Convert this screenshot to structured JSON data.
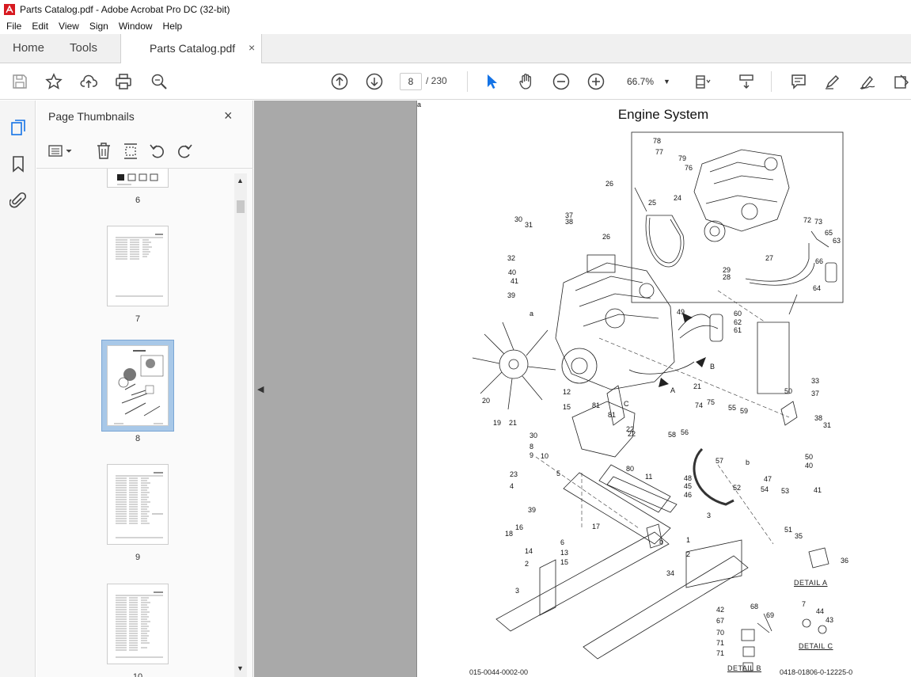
{
  "window": {
    "title": "Parts Catalog.pdf - Adobe Acrobat Pro DC (32-bit)"
  },
  "menu": [
    "File",
    "Edit",
    "View",
    "Sign",
    "Window",
    "Help"
  ],
  "tabs": {
    "home": "Home",
    "tools": "Tools",
    "document": "Parts Catalog.pdf",
    "close": "×"
  },
  "toolbar": {
    "current_page": "8",
    "total_pages": "/ 230",
    "zoom": "66.7%"
  },
  "thumbnails_panel": {
    "title": "Page Thumbnails",
    "close": "×",
    "pages": [
      "6",
      "7",
      "8",
      "9",
      "10"
    ],
    "selected_page": "8"
  },
  "document": {
    "title": "Engine System",
    "code_left": "015-0044-0002-00",
    "code_right": "0418-01806-0-12225-0",
    "details": [
      "DETAIL A",
      "DETAIL B",
      "DETAIL C"
    ],
    "callouts": [
      "78",
      "77",
      "79",
      "76",
      "26",
      "25",
      "24",
      "27",
      "72",
      "73",
      "65",
      "63",
      "66",
      "64",
      "29",
      "28",
      "30",
      "31",
      "37",
      "38",
      "32",
      "40",
      "41",
      "39",
      "26",
      "60",
      "62",
      "61",
      "20",
      "19",
      "12",
      "15",
      "81",
      "81",
      "21",
      "22",
      "22",
      "21",
      "74",
      "75",
      "55",
      "59",
      "58",
      "56",
      "57",
      "50",
      "33",
      "37",
      "38",
      "31",
      "30",
      "8",
      "9",
      "10",
      "80",
      "23",
      "4",
      "5",
      "11",
      "48",
      "45",
      "46",
      "47",
      "54",
      "53",
      "52",
      "50",
      "40",
      "41",
      "39",
      "16",
      "18",
      "17",
      "6",
      "13",
      "15",
      "14",
      "2",
      "3",
      "1",
      "2",
      "3",
      "51",
      "35",
      "36",
      "34",
      "7",
      "44",
      "43",
      "42",
      "67",
      "68",
      "69",
      "70",
      "71",
      "71",
      "49",
      "A",
      "B",
      "C",
      "a",
      "b",
      "b",
      "a"
    ]
  },
  "colors": {
    "accent": "#1473e6",
    "canvas": "#a9a9a9",
    "selection": "#a8c8e8"
  }
}
